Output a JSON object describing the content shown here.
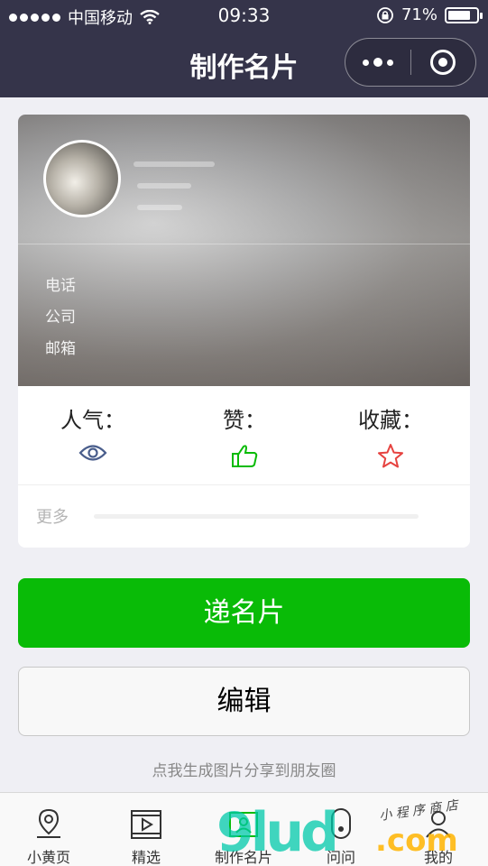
{
  "status_bar": {
    "carrier": "中国移动",
    "time": "09:33",
    "battery": "71%",
    "battery_level": 0.71
  },
  "nav": {
    "title": "制作名片"
  },
  "card": {
    "fields": [
      {
        "label": "电话"
      },
      {
        "label": "公司"
      },
      {
        "label": "邮箱"
      }
    ],
    "stats": {
      "popularity_label": "人气：",
      "likes_label": "赞：",
      "favorites_label": "收藏："
    },
    "more_label": "更多"
  },
  "actions": {
    "send_label": "递名片",
    "edit_label": "编辑",
    "share_hint": "点我生成图片分享到朋友圈"
  },
  "tabbar": {
    "items": [
      {
        "label": "小黄页",
        "icon": "location-pin-icon"
      },
      {
        "label": "精选",
        "icon": "video-play-icon"
      },
      {
        "label": "制作名片",
        "icon": "card-icon"
      },
      {
        "label": "问问",
        "icon": "ask-icon"
      },
      {
        "label": "我的",
        "icon": "profile-icon"
      }
    ],
    "active_index": 2
  },
  "watermark": {
    "text": "9lud",
    "domain": ".com",
    "script": "小 程 序 商 店"
  },
  "colors": {
    "nav_bg": "#35344a",
    "primary": "#09bb07",
    "view_icon": "#4a5e8c",
    "like_icon": "#09bb07",
    "fav_icon": "#e64340"
  }
}
